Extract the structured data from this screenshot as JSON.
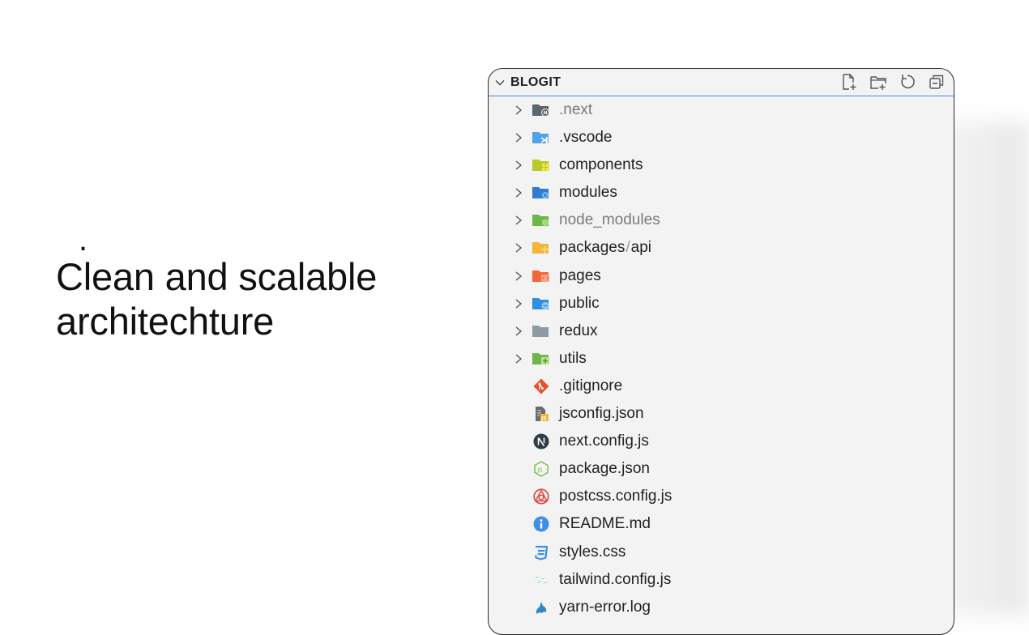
{
  "headline": {
    "bullet": ".",
    "line1": "Clean and scalable",
    "line2": "architechture"
  },
  "explorer": {
    "title": "BLOGIT",
    "actions": [
      "new-file-icon",
      "new-folder-icon",
      "refresh-icon",
      "collapse-all-icon"
    ],
    "folders": [
      {
        "label": ".next",
        "dim": true,
        "icon": "next-folder-icon",
        "color": "#5b6770"
      },
      {
        "label": ".vscode",
        "dim": false,
        "icon": "vscode-folder-icon",
        "color": "#4fa3e6"
      },
      {
        "label": "components",
        "dim": false,
        "icon": "components-folder-icon",
        "color": "#b8c92a"
      },
      {
        "label": "modules",
        "dim": false,
        "icon": "modules-folder-icon",
        "color": "#2f7dd1"
      },
      {
        "label": "node_modules",
        "dim": true,
        "icon": "node-folder-icon",
        "color": "#6fb64a"
      },
      {
        "label_a": "packages",
        "label_sep": "/",
        "label_b": "api",
        "dim": false,
        "icon": "packages-folder-icon",
        "color": "#f2b63a"
      },
      {
        "label": "pages",
        "dim": false,
        "icon": "pages-folder-icon",
        "color": "#f0663d"
      },
      {
        "label": "public",
        "dim": false,
        "icon": "public-folder-icon",
        "color": "#2f8fe0"
      },
      {
        "label": "redux",
        "dim": false,
        "icon": "folder-icon",
        "color": "#8f9aa3"
      },
      {
        "label": "utils",
        "dim": false,
        "icon": "utils-folder-icon",
        "color": "#6fb64a"
      }
    ],
    "files": [
      {
        "label": ".gitignore",
        "icon": "git-icon",
        "color": "#e5532d"
      },
      {
        "label": "jsconfig.json",
        "icon": "jsconfig-icon",
        "color": "#f2b63a"
      },
      {
        "label": "next.config.js",
        "icon": "nextjs-icon",
        "color": "#2f3b46"
      },
      {
        "label": "package.json",
        "icon": "nodejs-icon",
        "color": "#7bb943"
      },
      {
        "label": "postcss.config.js",
        "icon": "postcss-icon",
        "color": "#e0403a"
      },
      {
        "label": "README.md",
        "icon": "info-icon",
        "color": "#3e8fe6"
      },
      {
        "label": "styles.css",
        "icon": "css-icon",
        "color": "#3e8fe6"
      },
      {
        "label": "tailwind.config.js",
        "icon": "tailwind-icon",
        "color": "#3fb5a8"
      },
      {
        "label": "yarn-error.log",
        "icon": "yarn-icon",
        "color": "#2e88c7"
      }
    ]
  }
}
